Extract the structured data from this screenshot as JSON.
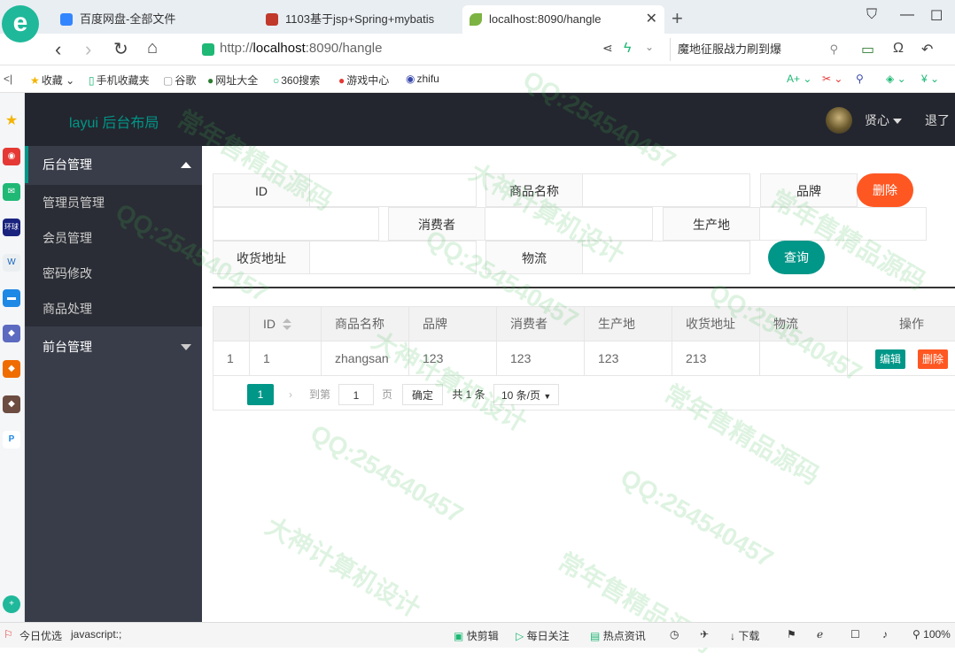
{
  "browser": {
    "tabs": [
      {
        "title": "百度网盘-全部文件",
        "active": false,
        "icon_color": "#3385ff"
      },
      {
        "title": "1103基于jsp+Spring+mybatis",
        "active": false,
        "icon_color": "#c0392b"
      },
      {
        "title": "localhost:8090/hangle",
        "active": true,
        "icon_color": "#7cb342"
      }
    ],
    "url_prefix": "http://",
    "url_host": "localhost",
    "url_rest": ":8090/hangle",
    "search_text": "魔地征服战力刷到爆",
    "bookmarks": [
      {
        "label": "收藏",
        "icon": "star-icon",
        "glyph": "★"
      },
      {
        "label": "手机收藏夹",
        "icon": "phone-icon",
        "glyph": "▯"
      },
      {
        "label": "谷歌",
        "icon": "doc-icon",
        "glyph": "▢"
      },
      {
        "label": "网址大全",
        "icon": "globe-icon",
        "glyph": "●"
      },
      {
        "label": "360搜索",
        "icon": "search-icon",
        "glyph": "○"
      },
      {
        "label": "游戏中心",
        "icon": "game-icon",
        "glyph": "●"
      },
      {
        "label": "zhifu",
        "icon": "site-icon",
        "glyph": "◉"
      }
    ],
    "status": {
      "left1": "今日优选",
      "left2": "javascript:;",
      "r1": "快剪辑",
      "r2": "每日关注",
      "r3": "热点资讯",
      "r4": "下载",
      "zoom": "100%"
    }
  },
  "app": {
    "logo": "layui 后台布局",
    "user": "贤心",
    "logout": "退了"
  },
  "nav": {
    "group1": "后台管理",
    "items": [
      "管理员管理",
      "会员管理",
      "密码修改",
      "商品处理"
    ],
    "group2": "前台管理"
  },
  "form": {
    "id_label": "ID",
    "name_label": "商品名称",
    "brand_label": "品牌",
    "delete_button": "删除",
    "consumer_label": "消费者",
    "origin_label": "生产地",
    "address_label": "收货地址",
    "logistics_label": "物流",
    "query_button": "查询"
  },
  "table": {
    "headers": [
      "",
      "ID",
      "商品名称",
      "品牌",
      "消费者",
      "生产地",
      "收货地址",
      "物流",
      "操作"
    ],
    "rows": [
      {
        "index": "1",
        "id": "1",
        "name": "zhangsan",
        "brand": "123",
        "consumer": "123",
        "origin": "123",
        "address": "213",
        "logistics": ""
      }
    ],
    "edit_label": "编辑",
    "delete_label": "删除"
  },
  "pager": {
    "current": "1",
    "goto_label": "到第",
    "page_value": "1",
    "page_unit": "页",
    "confirm": "确定",
    "total": "共 1 条",
    "per_page": "10 条/页"
  },
  "watermark": [
    "QQ:254540457",
    "大神计算机设计",
    "常年售精品源码"
  ],
  "colors": {
    "accent": "#009688",
    "danger": "#ff5722",
    "header": "#23262e",
    "sidebar": "#393d49"
  }
}
